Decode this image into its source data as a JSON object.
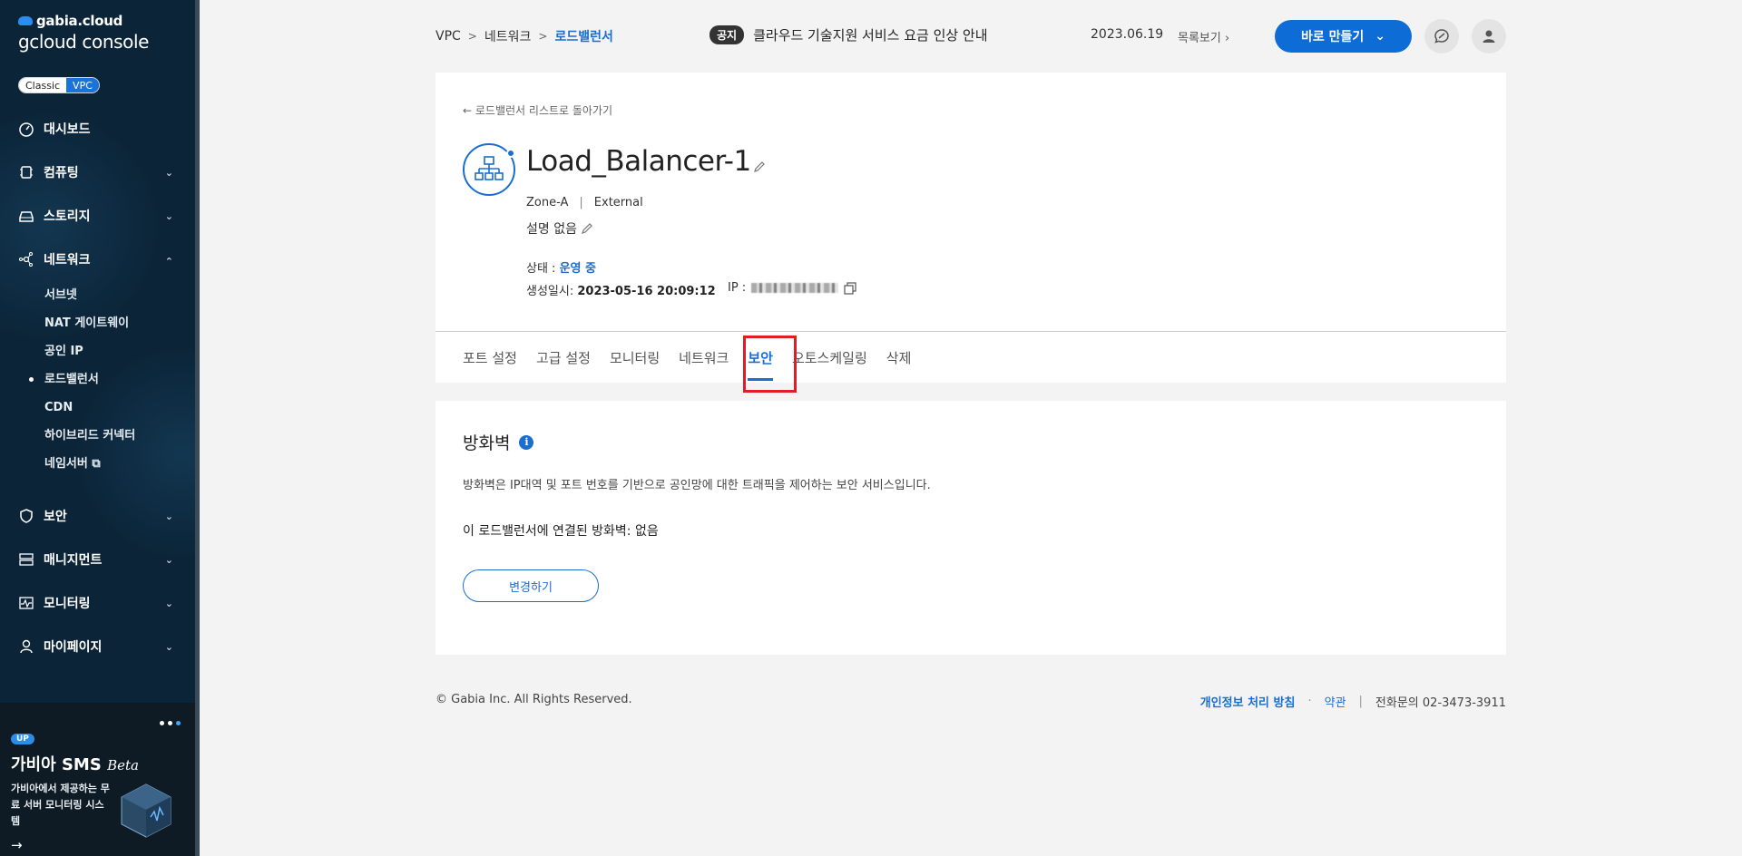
{
  "sidebar": {
    "brand": "gabia.cloud",
    "console": "gcloud console",
    "toggle": {
      "classic": "Classic",
      "vpc": "VPC"
    },
    "menu": {
      "dashboard": "대시보드",
      "computing": "컴퓨팅",
      "storage": "스토리지",
      "network": "네트워크",
      "security": "보안",
      "management": "매니지먼트",
      "monitoring": "모니터링",
      "mypage": "마이페이지"
    },
    "network_sub": {
      "subnet": "서브넷",
      "nat": "NAT 게이트웨이",
      "public_ip": "공인 IP",
      "load_balancer": "로드밸런서",
      "cdn": "CDN",
      "hybrid": "하이브리드 커넥터",
      "nameserver": "네임서버"
    },
    "promo": {
      "badge": "UP",
      "title": "가비아 SMS",
      "title_suffix": "Beta",
      "desc": "가비아에서 제공하는 무료 서버 모니터링 시스템"
    }
  },
  "header": {
    "breadcrumb": [
      "VPC",
      "네트워크",
      "로드밸런서"
    ],
    "notice_badge": "공지",
    "notice_text": "클라우드 기술지원 서비스 요금 인상 안내",
    "notice_date": "2023.06.19",
    "notice_more": "목록보기",
    "make_button": "바로 만들기"
  },
  "detail": {
    "back_link": "로드밸런서 리스트로 돌아가기",
    "name": "Load_Balancer-1",
    "zone": "Zone-A",
    "type": "External",
    "description": "설명 없음",
    "status_label": "상태 : ",
    "status_value": "운영 중",
    "created_label": "생성일시: ",
    "created_value": "2023-05-16 20:09:12",
    "ip_label": "IP : "
  },
  "tabs": [
    "포트 설정",
    "고급 설정",
    "모니터링",
    "네트워크",
    "보안",
    "오토스케일링",
    "삭제"
  ],
  "active_tab": "보안",
  "firewall": {
    "title": "방화벽",
    "description": "방화벽은 IP대역 및 포트 번호를 기반으로 공인망에 대한 트래픽을 제어하는 보안 서비스입니다.",
    "linked": "이 로드밸런서에 연결된 방화벽: 없음",
    "change_button": "변경하기"
  },
  "footer": {
    "copyright": "© Gabia Inc. All Rights Reserved.",
    "privacy": "개인정보 처리 방침",
    "terms": "약관",
    "phone_label": "전화문의",
    "phone": "02-3473-3911"
  },
  "colors": {
    "accent": "#1a6ed0",
    "sidebar": "#0b2438",
    "highlight": "#e21c24"
  }
}
